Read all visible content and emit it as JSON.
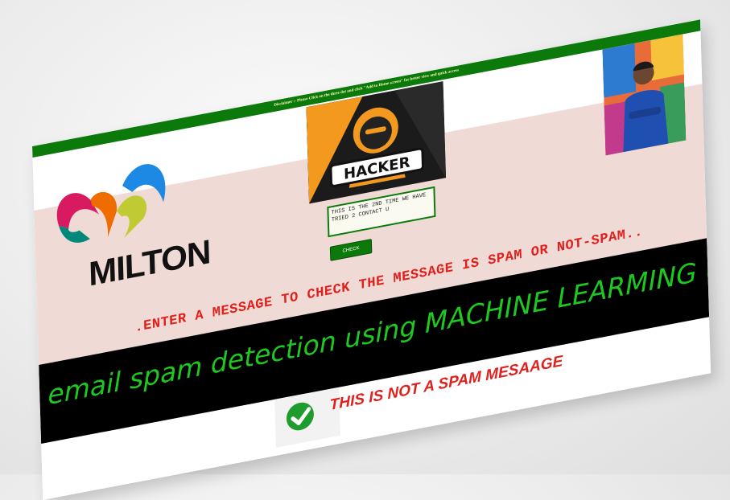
{
  "disclaimer": "Disclaimer :- Please Click on the three dot and click \"Add to Home screen\" for better view and quick access",
  "logo": {
    "text": "MILTON"
  },
  "hacker_image": {
    "caption": "HACKER"
  },
  "message_input": {
    "value": "THIS IS THE 2ND TIME WE HAVE TRIED 2 CONTACT U"
  },
  "check_button": {
    "label": "CHECK"
  },
  "instruction": ".ENTER A MESSAGE TO CHECK THE MESSAGE IS SPAM OR NOT-SPAM..",
  "project_title": "email spam detection using MACHINE LEARMING (B.TECH PROJECT)",
  "result": {
    "text": "THIS IS NOT A SPAM MESAAGE",
    "icon": "check-circle-icon"
  },
  "colors": {
    "green": "#0b7a0b",
    "bright_green": "#1ec820",
    "red": "#e0201c",
    "pink_band": "#f0dad6"
  }
}
